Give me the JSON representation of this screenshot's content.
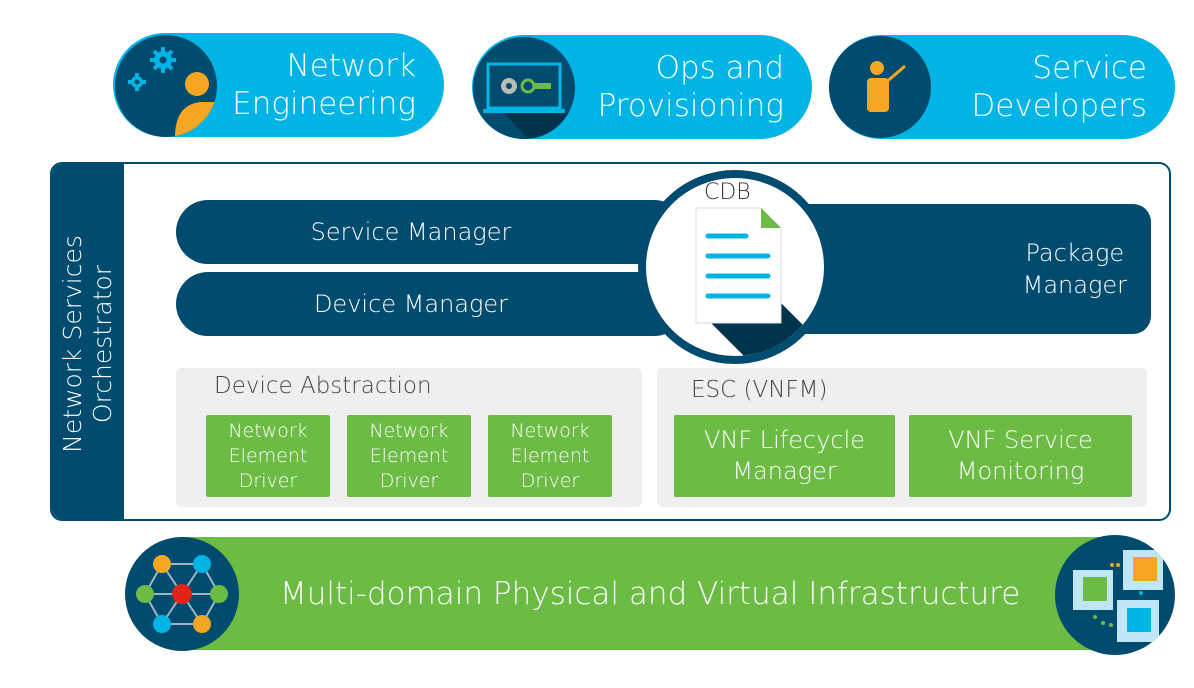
{
  "personas": [
    {
      "line1": "Network",
      "line2": "Engineering",
      "icon": "gears-person-icon"
    },
    {
      "line1": "Ops and",
      "line2": "Provisioning",
      "icon": "laptop-tools-icon"
    },
    {
      "line1": "Service",
      "line2": "Developers",
      "icon": "presenter-icon"
    }
  ],
  "nso": {
    "title_line1": "Network Services",
    "title_line2": "Orchestrator",
    "service_manager": "Service Manager",
    "device_manager": "Device Manager",
    "package_manager_line1": "Package",
    "package_manager_line2": "Manager",
    "cdb": "CDB",
    "device_abstraction": {
      "label": "Device Abstraction",
      "drivers": [
        [
          "Network",
          "Element",
          "Driver"
        ],
        [
          "Network",
          "Element",
          "Driver"
        ],
        [
          "Network",
          "Element",
          "Driver"
        ]
      ]
    },
    "esc": {
      "label": "ESC (VNFM)",
      "items": [
        [
          "VNF Lifecycle",
          "Manager"
        ],
        [
          "VNF Service",
          "Monitoring"
        ]
      ]
    }
  },
  "infrastructure": {
    "label": "Multi-domain Physical and Virtual Infrastructure",
    "left_icon": "network-mesh-icon",
    "right_icon": "virtual-cubes-icon"
  },
  "colors": {
    "cyan": "#00b5e6",
    "navy": "#004b6e",
    "green": "#6cbb45",
    "orange": "#f5a623"
  }
}
